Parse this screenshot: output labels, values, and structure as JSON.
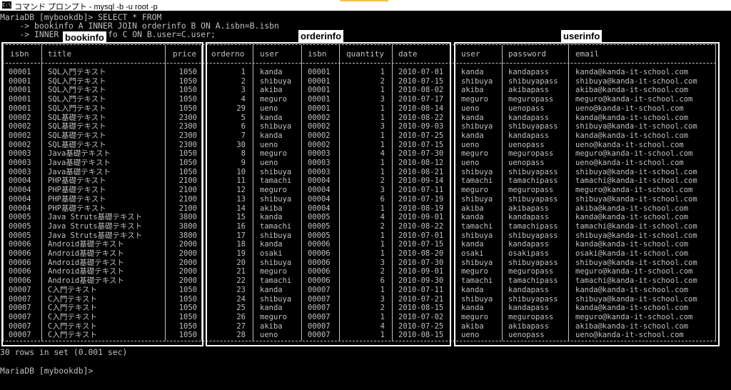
{
  "window": {
    "title": "コマンド プロンプト - mysql -b -u root -p"
  },
  "console": {
    "line1": "MariaDB [mybookdb]> SELECT * FROM",
    "line2": "    -> bookinfo A INNER JOIN orderinfo B ON A.isbn=B.isbn",
    "line3_a": "    -> INNER",
    "line3_b": "fo C ON B.user=C.user;",
    "summary": "30 rows in set (0.001 sec)",
    "prompt": "MariaDB [mybookdb]>"
  },
  "annotations": {
    "bookinfo": "bookinfo",
    "orderinfo": "orderinfo",
    "userinfo": "userinfo"
  },
  "headers": {
    "isbn": "isbn",
    "title": "title",
    "price": "price",
    "orderno": "orderno",
    "user": "user",
    "isbn2": "isbn",
    "quantity": "quantity",
    "date": "date",
    "user2": "user",
    "password": "password",
    "email": "email"
  },
  "columns": {
    "isbn": "00001\n00001\n00001\n00001\n00001\n00002\n00002\n00002\n00002\n00003\n00003\n00003\n00004\n00004\n00004\n00004\n00005\n00005\n00005\n00006\n00006\n00006\n00006\n00006\n00007\n00007\n00007\n00007\n00007\n00007",
    "title": "SQL入門テキスト\nSQL入門テキスト\nSQL入門テキスト\nSQL入門テキスト\nSQL入門テキスト\nSQL基礎テキスト\nSQL基礎テキスト\nSQL基礎テキスト\nSQL基礎テキスト\nJava基礎テキスト\nJava基礎テキスト\nJava基礎テキスト\nPHP基礎テキスト\nPHP基礎テキスト\nPHP基礎テキスト\nPHP基礎テキスト\nJava Struts基礎テキスト\nJava Struts基礎テキスト\nJava Struts基礎テキスト\nAndroid基礎テキスト\nAndroid基礎テキスト\nAndroid基礎テキスト\nAndroid基礎テキスト\nAndroid基礎テキスト\nC入門テキスト\nC入門テキスト\nC入門テキスト\nC入門テキスト\nC入門テキスト\nC入門テキスト",
    "price": "1050\n1050\n1050\n1050\n1050\n2300\n2300\n2300\n2300\n1050\n1050\n1050\n2100\n2100\n2100\n2100\n3800\n3800\n3800\n2000\n2000\n2000\n2000\n2000\n1050\n1050\n1050\n1050\n1050\n1050",
    "orderno": "1\n2\n3\n4\n29\n5\n6\n7\n30\n8\n9\n10\n11\n12\n13\n14\n15\n16\n17\n18\n19\n20\n21\n22\n23\n24\n25\n26\n27\n28",
    "user": "kanda\nshibuya\nakiba\nmeguro\nueno\nkanda\nshibuya\nkanda\nueno\nmeguro\nueno\nshibuya\ntamachi\nmeguro\nshibuya\nakiba\nkanda\ntamachi\nshibuya\nkanda\nosaki\nshibuya\nmeguro\ntamachi\nkanda\nshibuya\nkanda\nmeguro\nakiba\nueno",
    "isbn2": "00001\n00001\n00001\n00001\n00001\n00002\n00002\n00002\n00002\n00003\n00003\n00003\n00004\n00004\n00004\n00004\n00005\n00005\n00005\n00006\n00006\n00006\n00006\n00006\n00007\n00007\n00007\n00007\n00007\n00007",
    "quantity": "1\n2\n1\n3\n1\n1\n3\n1\n1\n4\n1\n1\n2\n3\n6\n1\n4\n2\n1\n1\n1\n3\n2\n6\n1\n3\n2\n1\n4\n1",
    "date": "2010-07-01\n2010-07-15\n2010-08-02\n2010-07-17\n2010-08-14\n2010-08-22\n2010-09-03\n2010-07-25\n2010-07-15\n2010-07-30\n2010-08-12\n2010-08-21\n2010-09-14\n2010-07-11\n2010-07-19\n2010-08-19\n2010-09-01\n2010-08-22\n2010-07-01\n2010-07-15\n2010-08-20\n2010-07-30\n2010-09-01\n2010-09-30\n2010-07-11\n2010-07-21\n2010-08-15\n2010-07-02\n2010-07-25\n2010-08-15",
    "user2": "kanda\nshibuya\nakiba\nmeguro\nueno\nkanda\nshibuya\nkanda\nueno\nmeguro\nueno\nshibuya\ntamachi\nmeguro\nshibuya\nakiba\nkanda\ntamachi\nshibuya\nkanda\nosaki\nshibuya\nmeguro\ntamachi\nkanda\nshibuya\nkanda\nmeguro\nakiba\nueno",
    "password": "kandapass\nshibuyapass\nakibapass\nmeguropass\nuenopass\nkandapass\nshibuyapass\nkandapass\nuenopass\nmeguropass\nuenopass\nshibuyapass\ntamachipass\nmeguropass\nshibuyapass\nakibapass\nkandapass\ntamachipass\nshibuyapass\nkandapass\nosakipass\nshibuyapass\nmeguropass\ntamachipass\nkandapass\nshibuyapass\nkandapass\nmeguropass\nakibapass\nuenopass",
    "email": "kanda@kanda-it-school.com\nshibuya@kanda-it-school.com\nakiba@kanda-it-school.com\nmeguro@kanda-it-school.com\nueno@kanda-it-school.com\nkanda@kanda-it-school.com\nshibuya@kanda-it-school.com\nkanda@kanda-it-school.com\nueno@kanda-it-school.com\nmeguro@kanda-it-school.com\nueno@kanda-it-school.com\nshibuya@kanda-it-school.com\ntamachi@kanda-it-school.com\nmeguro@kanda-it-school.com\nshibuya@kanda-it-school.com\nakiba@kanda-it-school.com\nkanda@kanda-it-school.com\ntamachi@kanda-it-school.com\nshibuya@kanda-it-school.com\nkanda@kanda-it-school.com\nosaki@kanda-it-school.com\nshibuya@kanda-it-school.com\nmeguro@kanda-it-school.com\ntamachi@kanda-it-school.com\nkanda@kanda-it-school.com\nshibuya@kanda-it-school.com\nkanda@kanda-it-school.com\nmeguro@kanda-it-school.com\nakiba@kanda-it-school.com\nueno@kanda-it-school.com"
  }
}
